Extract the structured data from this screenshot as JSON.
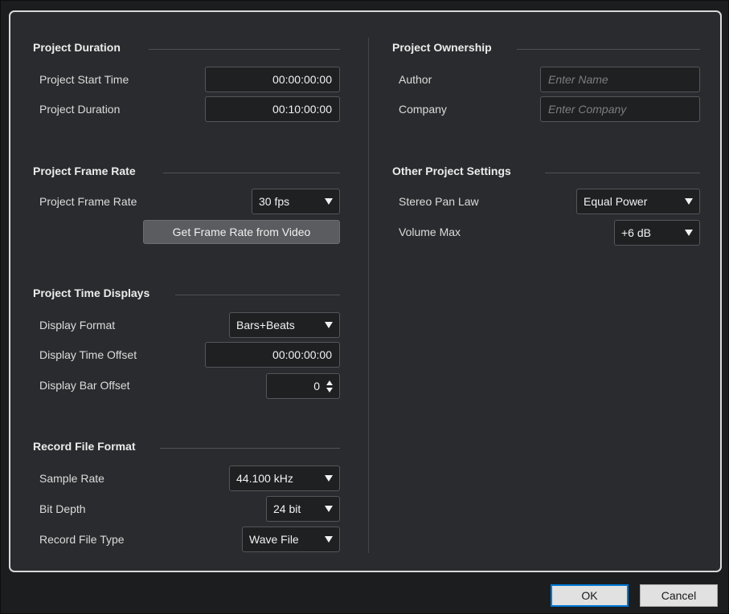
{
  "left": {
    "duration": {
      "title": "Project Duration",
      "start_label": "Project Start Time",
      "start_value": "00:00:00:00",
      "duration_label": "Project Duration",
      "duration_value": "00:10:00:00"
    },
    "frame_rate": {
      "title": "Project Frame Rate",
      "label": "Project Frame Rate",
      "value": "30 fps",
      "button": "Get Frame Rate from Video"
    },
    "time_displays": {
      "title": "Project Time Displays",
      "format_label": "Display Format",
      "format_value": "Bars+Beats",
      "time_offset_label": "Display Time Offset",
      "time_offset_value": "00:00:00:00",
      "bar_offset_label": "Display Bar Offset",
      "bar_offset_value": "0"
    },
    "record_format": {
      "title": "Record File Format",
      "sample_rate_label": "Sample Rate",
      "sample_rate_value": "44.100 kHz",
      "bit_depth_label": "Bit Depth",
      "bit_depth_value": "24 bit",
      "file_type_label": "Record File Type",
      "file_type_value": "Wave File"
    }
  },
  "right": {
    "ownership": {
      "title": "Project Ownership",
      "author_label": "Author",
      "author_placeholder": "Enter Name",
      "company_label": "Company",
      "company_placeholder": "Enter Company"
    },
    "other": {
      "title": "Other Project Settings",
      "pan_law_label": "Stereo Pan Law",
      "pan_law_value": "Equal Power",
      "volume_max_label": "Volume Max",
      "volume_max_value": "+6 dB"
    }
  },
  "footer": {
    "ok_label": "OK",
    "cancel_label": "Cancel"
  }
}
